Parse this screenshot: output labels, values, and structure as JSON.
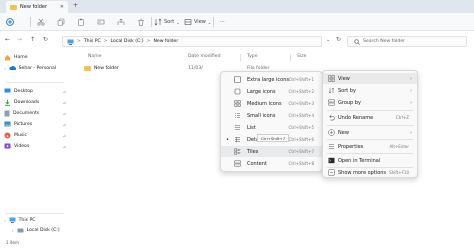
{
  "window": {
    "tab_title": "New folder"
  },
  "toolbar": {
    "sort_label": "Sort",
    "view_label": "View",
    "more_label": "···"
  },
  "address": {
    "segments": [
      "This PC",
      "Local Disk (C:)",
      "New folder"
    ],
    "separator": ">"
  },
  "search": {
    "placeholder": "Search New folder"
  },
  "sidebar": {
    "items": [
      {
        "label": "Home",
        "icon": "home-icon"
      },
      {
        "label": "Sehar - Personal",
        "icon": "cloud-icon"
      },
      {
        "label": "Desktop",
        "icon": "desktop-icon"
      },
      {
        "label": "Downloads",
        "icon": "download-icon"
      },
      {
        "label": "Documents",
        "icon": "documents-icon"
      },
      {
        "label": "Pictures",
        "icon": "pictures-icon"
      },
      {
        "label": "Music",
        "icon": "music-icon"
      },
      {
        "label": "Videos",
        "icon": "videos-icon"
      },
      {
        "label": "This PC",
        "icon": "pc-icon"
      },
      {
        "label": "Local Disk (C:)",
        "icon": "disk-icon"
      }
    ],
    "pin_glyph": "⊿"
  },
  "columns": {
    "name": "Name",
    "date": "Date modified",
    "type": "Type",
    "size": "Size"
  },
  "files": [
    {
      "name": "New folder",
      "date": "11/03/",
      "type": "File folder"
    }
  ],
  "view_menu": {
    "items": [
      {
        "label": "Extra large icons",
        "shortcut": "Ctrl+Shift+1"
      },
      {
        "label": "Large icons",
        "shortcut": "Ctrl+Shift+2"
      },
      {
        "label": "Medium icons",
        "shortcut": "Ctrl+Shift+3"
      },
      {
        "label": "Small icons",
        "shortcut": "Ctrl+Shift+4"
      },
      {
        "label": "List",
        "shortcut": "Ctrl+Shift+5"
      },
      {
        "label": "Details",
        "shortcut": "Ctrl+Shift+6"
      },
      {
        "label": "Tiles",
        "shortcut": "Ctrl+Shift+7"
      },
      {
        "label": "Content",
        "shortcut": "Ctrl+Shift+8"
      }
    ],
    "tooltip": "Ctrl+Shift+7"
  },
  "context_menu": {
    "items": [
      {
        "label": "View",
        "arrow": "›"
      },
      {
        "label": "Sort by",
        "arrow": "›"
      },
      {
        "label": "Group by",
        "arrow": "›"
      },
      {
        "label": "Undo Rename",
        "shortcut": "Ctrl+Z"
      },
      {
        "label": "New",
        "arrow": "›"
      },
      {
        "label": "Properties",
        "shortcut": "Alt+Enter"
      },
      {
        "label": "Open in Terminal"
      },
      {
        "label": "Show more options",
        "shortcut": "Shift+F10"
      }
    ]
  },
  "status": {
    "count": "1 item"
  },
  "colors": {
    "accent": "#0067c0",
    "folder": "#f2c34f",
    "title_bar": "#dfe6ee"
  }
}
